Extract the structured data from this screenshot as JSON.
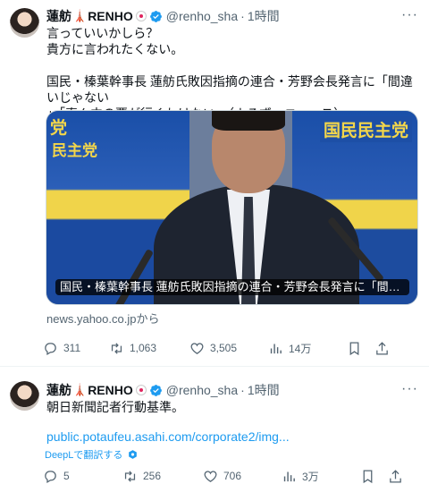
{
  "tweets": [
    {
      "author": {
        "name": "蓮舫",
        "name_suffix": "RENHO",
        "handle": "@renho_sha",
        "time": "1時間"
      },
      "text_lines": [
        "言っていいかしら？",
        "貴方に言われたくない。",
        "",
        "国民・榛葉幹事長 蓮舫氏敗因指摘の連合・芳野会長発言に「間違いじゃない",
        "」「真ん中の票が行くわけない」（よろず〜ニュース）"
      ],
      "card": {
        "sign_left": "党",
        "sign_left2": "民主党",
        "sign_right": "国民民主党",
        "caption": "国民・榛葉幹事長 蓮舫氏敗因指摘の連合・芳野会長発言に「間違いじゃない」「...",
        "source": "news.yahoo.co.jpから"
      },
      "actions": {
        "replies": "311",
        "retweets": "1,063",
        "likes": "3,505",
        "views": "14万"
      }
    },
    {
      "author": {
        "name": "蓮舫",
        "name_suffix": "RENHO",
        "handle": "@renho_sha",
        "time": "1時間"
      },
      "text_lines": [
        "朝日新聞記者行動基準。"
      ],
      "link": "public.potaufeu.asahi.com/corporate2/img...",
      "translate_label": "DeepLで翻訳する",
      "actions": {
        "replies": "5",
        "retweets": "256",
        "likes": "706",
        "views": "3万"
      }
    }
  ],
  "icons": [
    "reply-icon",
    "retweet-icon",
    "like-icon",
    "views-icon",
    "bookmark-icon",
    "share-icon",
    "more-icon",
    "verified-icon"
  ],
  "colors": {
    "accent": "#1d9bf0",
    "text": "#0f1419",
    "secondary": "#536471"
  }
}
